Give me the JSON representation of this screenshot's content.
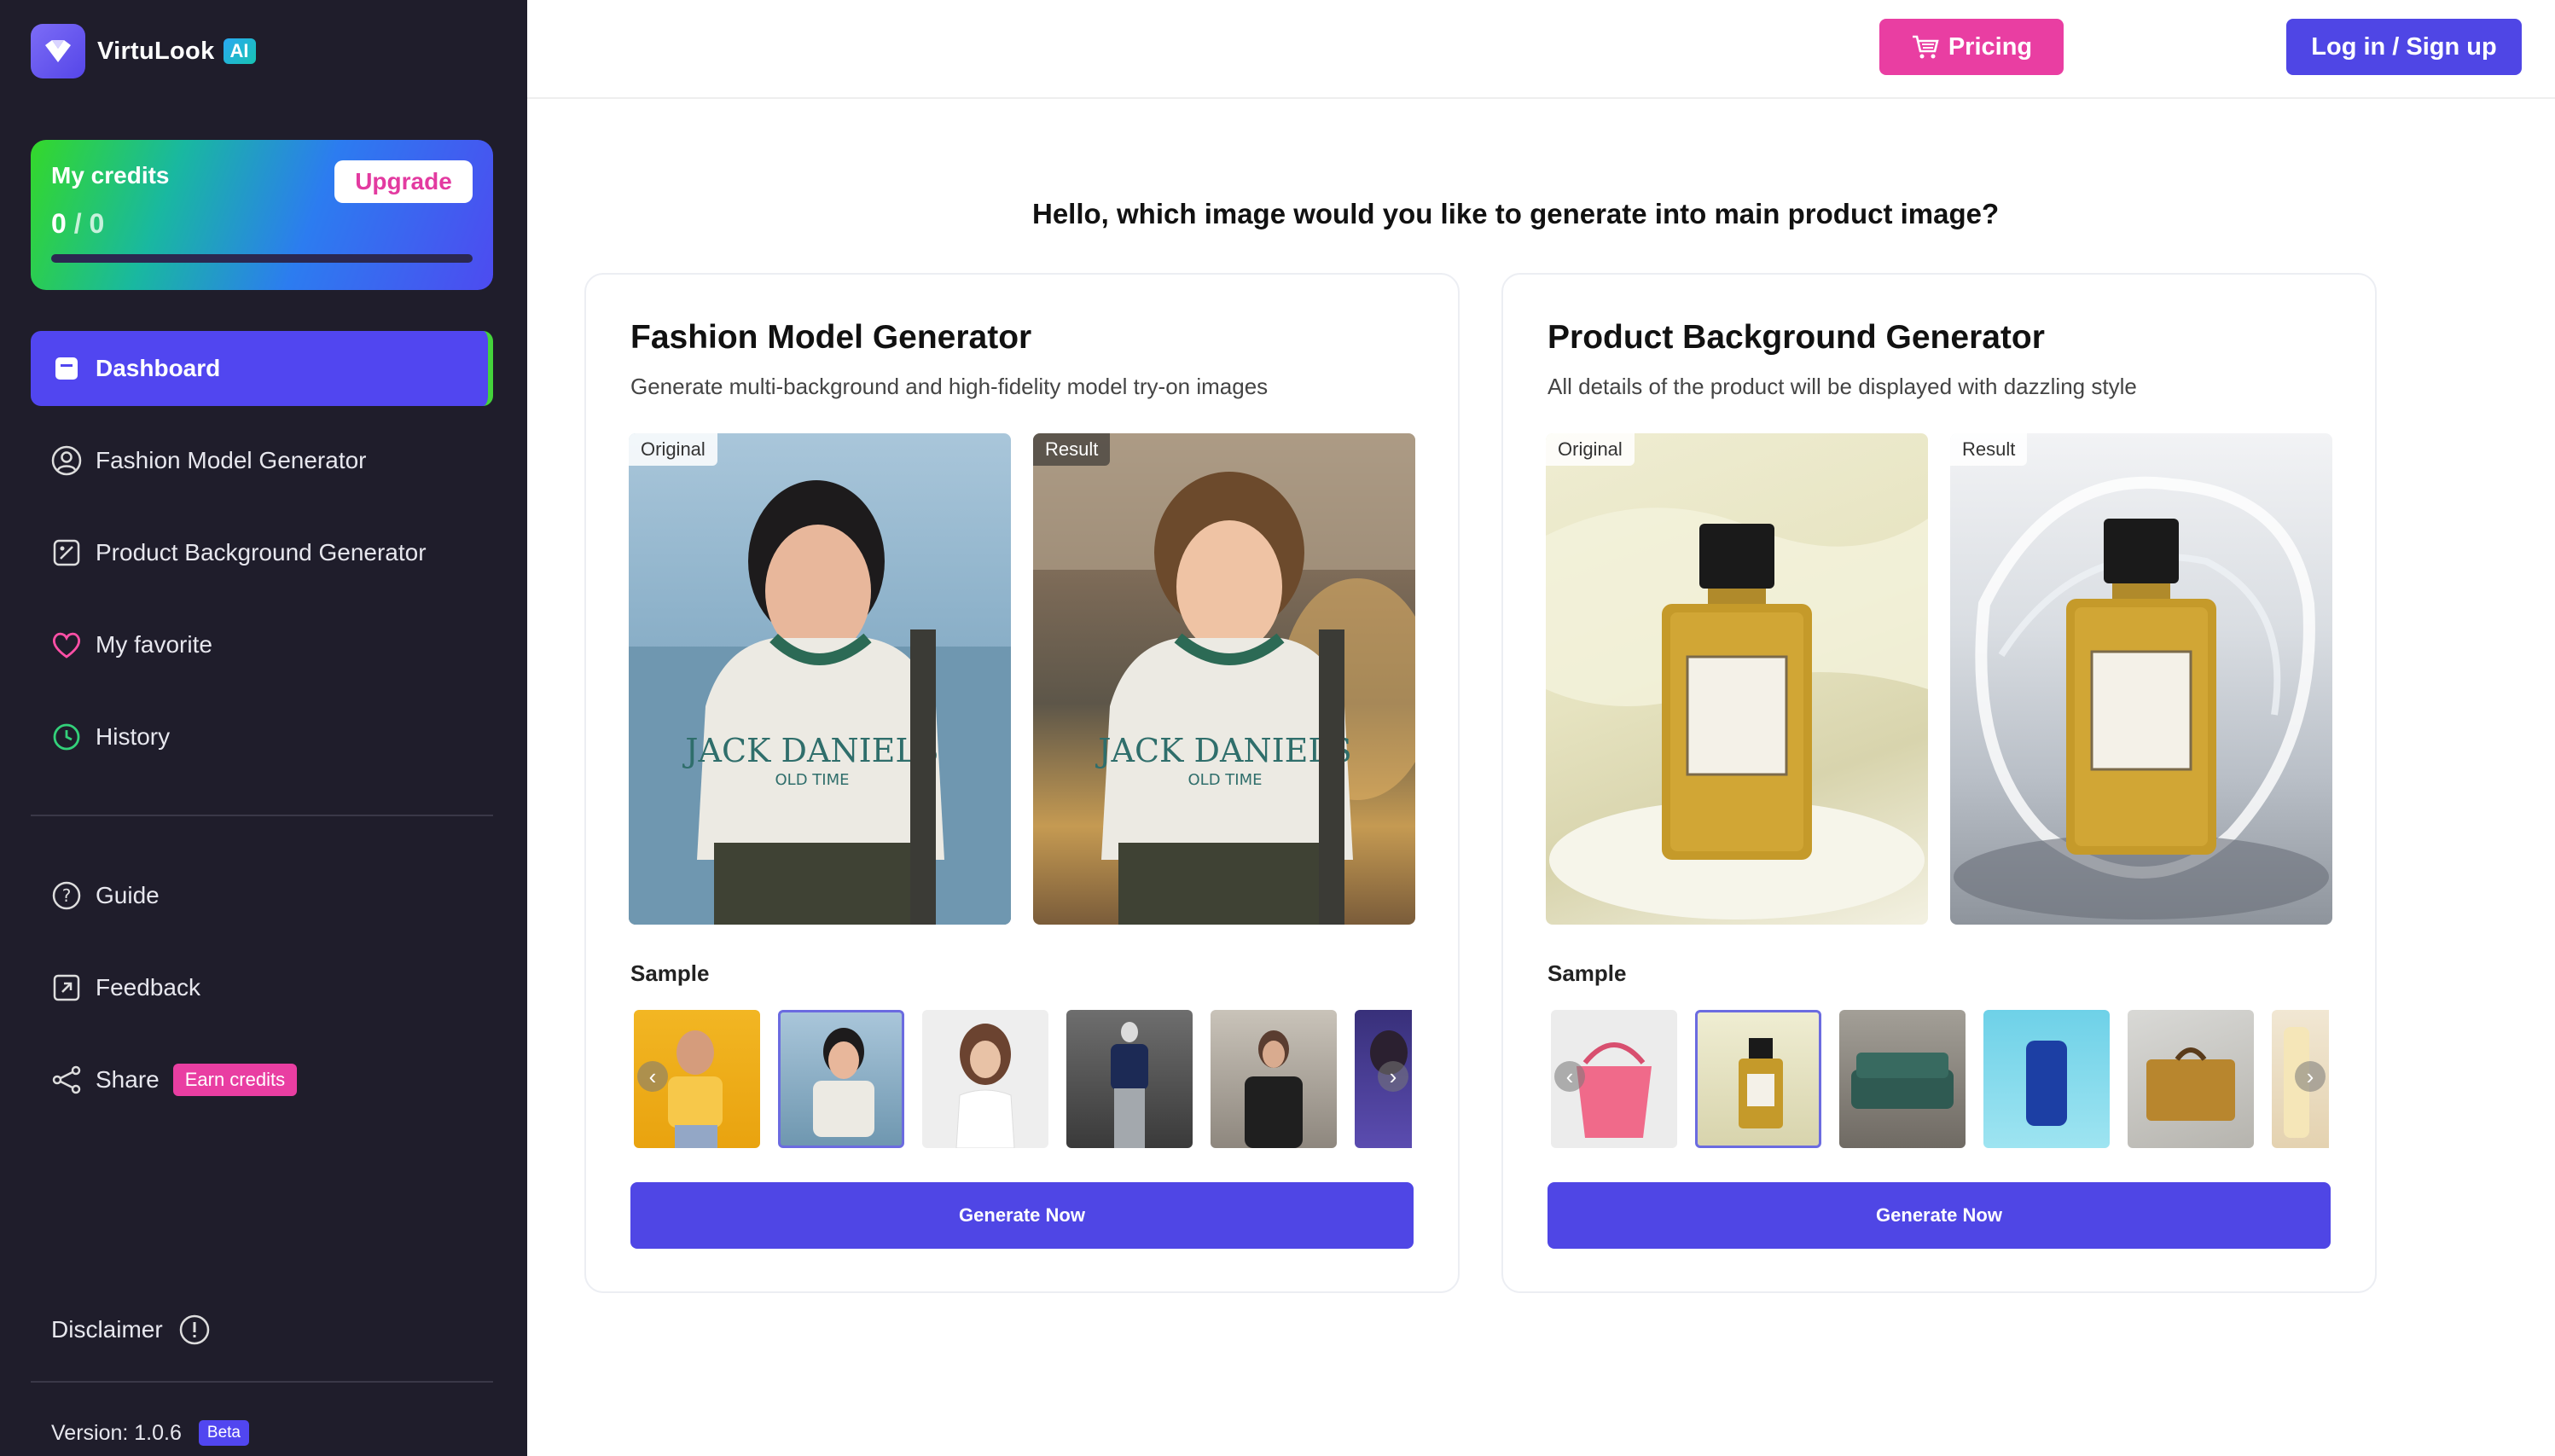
{
  "brand": {
    "name": "VirtuLook",
    "badge": "AI"
  },
  "credits": {
    "title": "My credits",
    "used": "0",
    "separator": " / ",
    "total": "0",
    "upgrade_label": "Upgrade"
  },
  "nav": {
    "items": [
      {
        "label": "Dashboard",
        "icon": "dashboard-icon"
      },
      {
        "label": "Fashion Model Generator",
        "icon": "user-circle-icon"
      },
      {
        "label": "Product Background Generator",
        "icon": "image-edit-icon"
      },
      {
        "label": "My favorite",
        "icon": "heart-icon"
      },
      {
        "label": "History",
        "icon": "whatsapp-history-icon"
      }
    ],
    "secondary": [
      {
        "label": "Guide",
        "icon": "help-circle-icon"
      },
      {
        "label": "Feedback",
        "icon": "external-link-icon"
      },
      {
        "label": "Share",
        "icon": "share-icon",
        "badge": "Earn credits"
      }
    ]
  },
  "footer": {
    "disclaimer": "Disclaimer",
    "version": "Version: 1.0.6",
    "beta": "Beta"
  },
  "header": {
    "pricing_label": "Pricing",
    "login_label": "Log in / Sign up"
  },
  "main": {
    "question": "Hello, which image would you like to generate into main product image?",
    "cards": [
      {
        "title": "Fashion Model Generator",
        "subtitle": "Generate multi-background and high-fidelity model try-on images",
        "original_tag": "Original",
        "result_tag": "Result",
        "sample_label": "Sample",
        "button": "Generate Now"
      },
      {
        "title": "Product Background Generator",
        "subtitle": "All details of the product will be displayed with dazzling style",
        "original_tag": "Original",
        "result_tag": "Result",
        "sample_label": "Sample",
        "button": "Generate Now"
      }
    ]
  },
  "colors": {
    "accent": "#4f46e5",
    "pink": "#e93ea2",
    "sidebar": "#1f1d2b",
    "active_indicator": "#44d33b"
  }
}
